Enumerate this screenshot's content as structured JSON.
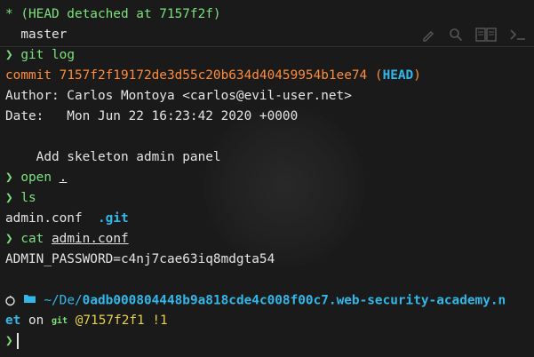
{
  "branches": {
    "current": "* (HEAD detached at 7157f2f)",
    "other": "  master"
  },
  "prompt_symbol": "❯",
  "commands": {
    "git_log": "git log",
    "open": "open",
    "open_arg": ".",
    "ls": "ls",
    "cat": "cat",
    "cat_arg": "admin.conf"
  },
  "log": {
    "commit_label": "commit",
    "commit_hash": "7157f2f19172de3d55c20b634d40459954b1ee74",
    "head_open": "(",
    "head": "HEAD",
    "head_close": ")",
    "author": "Author: Carlos Montoya <carlos@evil-user.net>",
    "date": "Date:   Mon Jun 22 16:23:42 2020 +0000",
    "message": "    Add skeleton admin panel"
  },
  "ls_output": {
    "file1": "admin.conf",
    "file2": ".git"
  },
  "cat_output": "ADMIN_PASSWORD=c4nj7cae63iq8mdgta54",
  "prompt": {
    "path_prefix": "~/De/",
    "path_dir_part1": "0adb000804448b9a818cde4c008f00c7.web-security-academy.n",
    "path_dir_part2": "et",
    "on": " on ",
    "git_label": "git",
    "commit_ref": " @7157f2f1",
    "status": " !1"
  },
  "colors": {
    "background": "#1a1a1a",
    "prompt_green": "#7ee07e",
    "commit_orange": "#ff8c3a",
    "path_cyan": "#33b7e8",
    "status_yellow": "#e6d04a"
  },
  "icons": [
    "edit-icon",
    "search-icon",
    "book-icon",
    "terminal-icon",
    "folder-icon",
    "apple-icon"
  ]
}
